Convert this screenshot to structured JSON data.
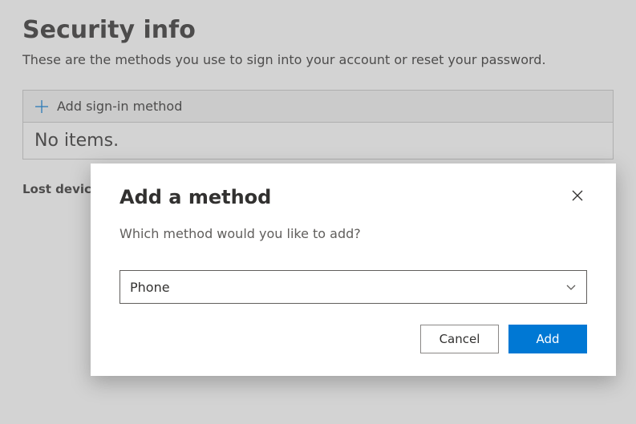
{
  "header": {
    "title": "Security info",
    "subtitle": "These are the methods you use to sign into your account or reset your password."
  },
  "methods_panel": {
    "add_label": "Add sign-in method",
    "empty_label": "No items."
  },
  "lost_device_label": "Lost device?",
  "dialog": {
    "title": "Add a method",
    "subtitle": "Which method would you like to add?",
    "selected_value": "Phone",
    "cancel_label": "Cancel",
    "add_label": "Add"
  }
}
